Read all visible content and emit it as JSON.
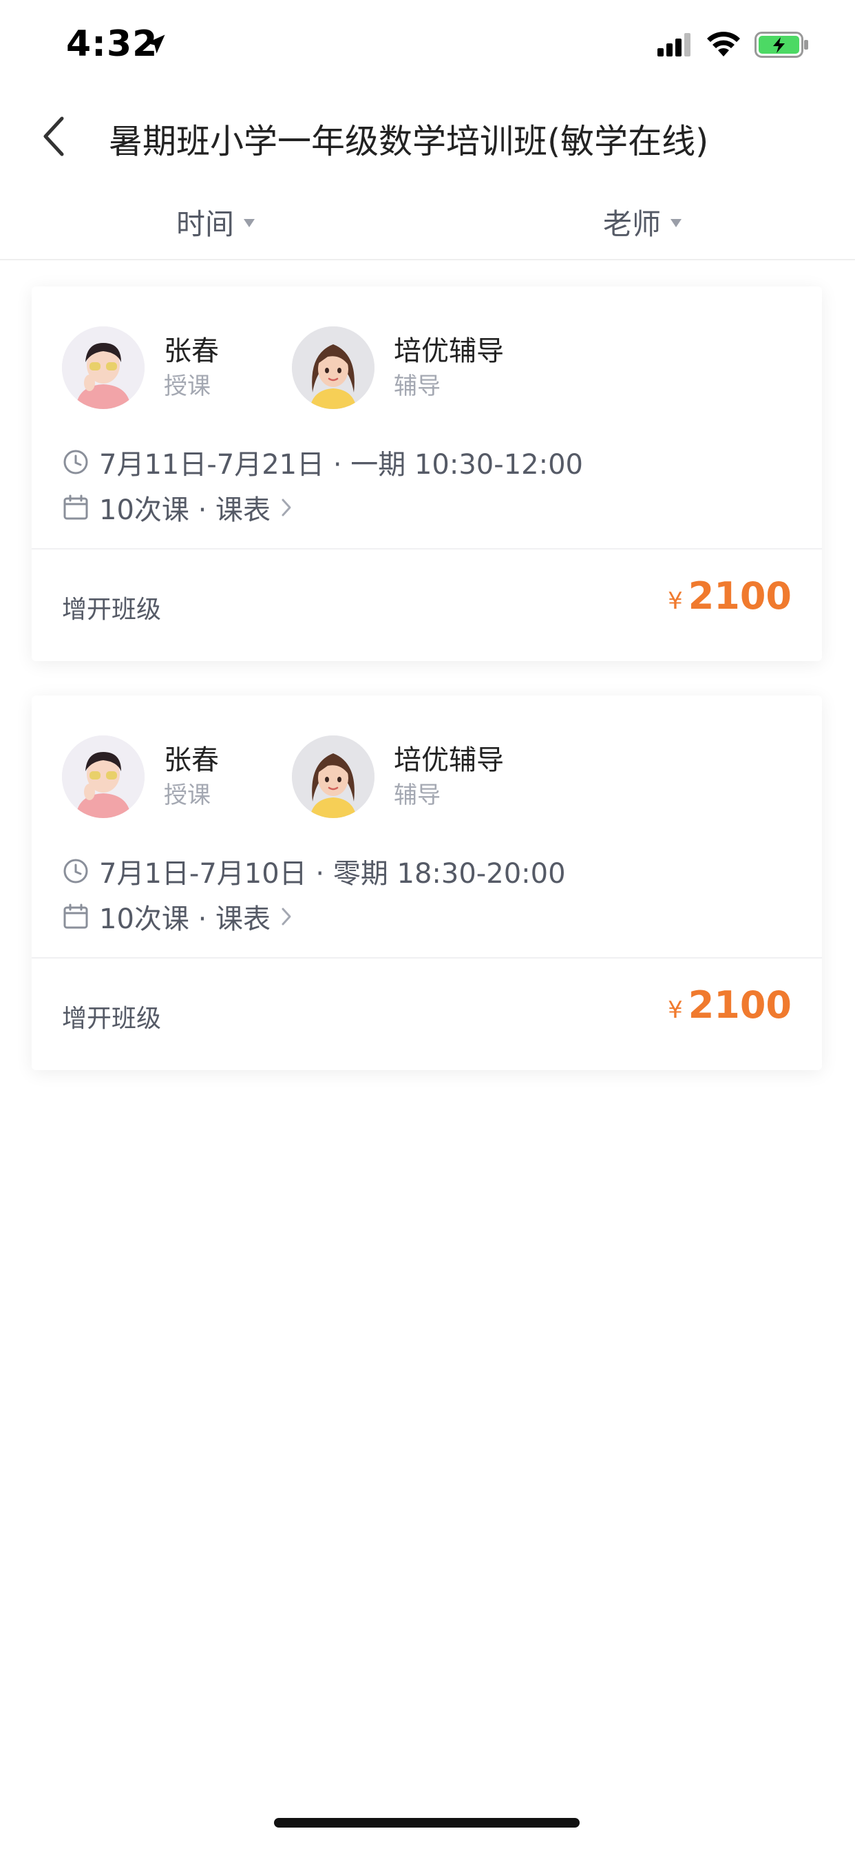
{
  "status_bar": {
    "time": "4:32"
  },
  "nav": {
    "title": "暑期班小学一年级数学培训班(敏学在线)"
  },
  "filters": [
    {
      "label": "时间"
    },
    {
      "label": "老师"
    }
  ],
  "classes": [
    {
      "teachers": [
        {
          "name": "张春",
          "role": "授课"
        },
        {
          "name": "培优辅导",
          "role": "辅导"
        }
      ],
      "schedule": "7月11日-7月21日 · 一期 10:30-12:00",
      "lessons": "10次课 · 课表",
      "add_class_label": "增开班级",
      "currency_symbol": "¥",
      "price": "2100"
    },
    {
      "teachers": [
        {
          "name": "张春",
          "role": "授课"
        },
        {
          "name": "培优辅导",
          "role": "辅导"
        }
      ],
      "schedule": "7月1日-7月10日 · 零期 18:30-20:00",
      "lessons": "10次课 · 课表",
      "add_class_label": "增开班级",
      "currency_symbol": "¥",
      "price": "2100"
    }
  ],
  "colors": {
    "accent_price": "#f07a2e",
    "text_secondary": "#555a66",
    "text_muted": "#a4a8b2",
    "battery_green": "#4cd964"
  }
}
